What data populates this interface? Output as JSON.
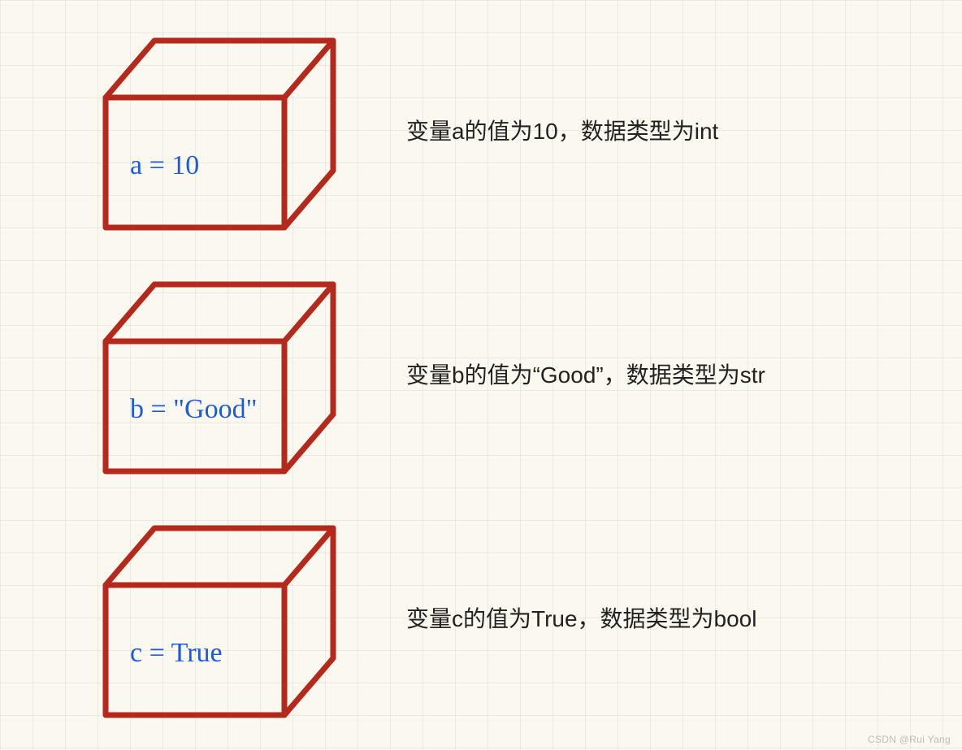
{
  "boxes": [
    {
      "handwritten": "a = 10",
      "description": "变量a的值为10，数据类型为int"
    },
    {
      "handwritten": "b = \"Good\"",
      "description": "变量b的值为“Good”，数据类型为str"
    },
    {
      "handwritten": "c = True",
      "description": "变量c的值为True，数据类型为bool"
    }
  ],
  "colors": {
    "box_stroke": "#b5291d",
    "handwriting": "#1a5be0",
    "text": "#222222",
    "bg": "#faf8ef"
  },
  "watermark": "CSDN @Rui Yang"
}
